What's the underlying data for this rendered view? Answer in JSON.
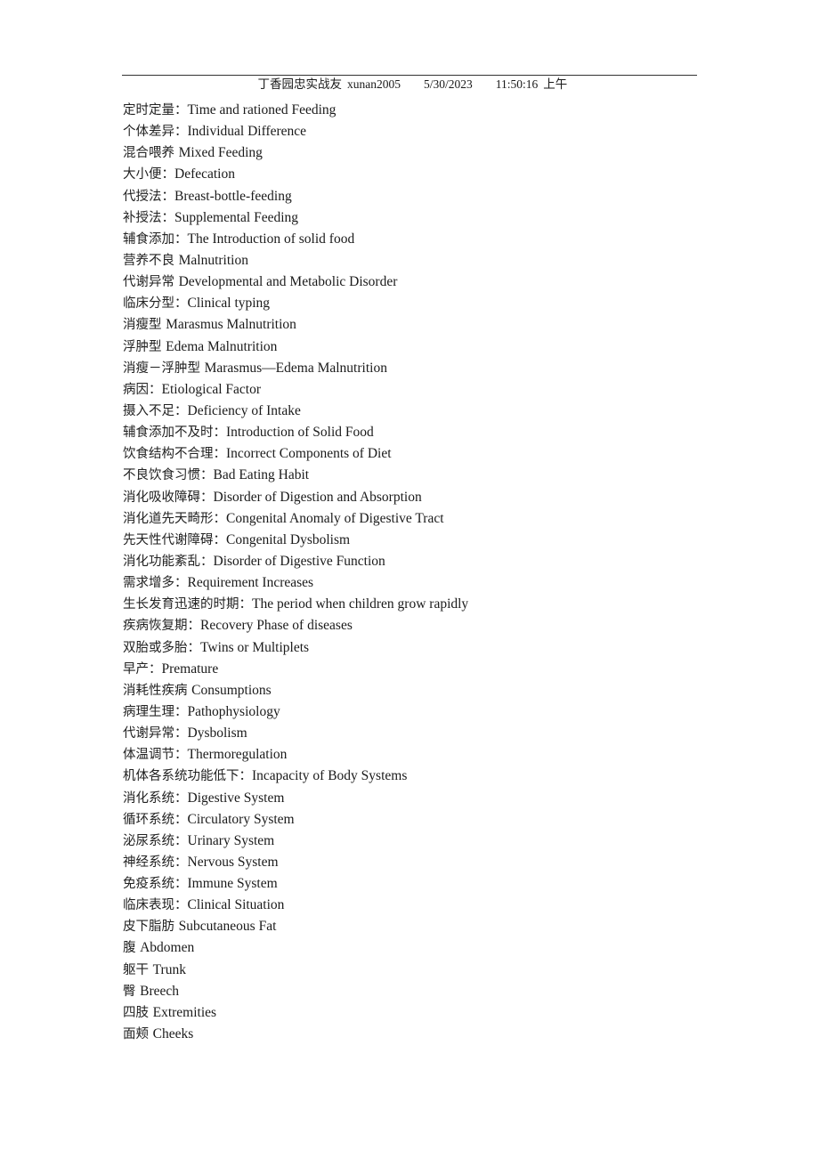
{
  "header": {
    "author": "丁香园忠实战友",
    "username": "xunan2005",
    "date": "5/30/2023",
    "time": "11:50:16",
    "ampm": "上午"
  },
  "entries": [
    {
      "zh": "定时定量：",
      "en": "Time and rationed Feeding"
    },
    {
      "zh": "个体差异：",
      "en": "Individual Difference"
    },
    {
      "zh": "混合喂养 ",
      "en": "Mixed Feeding"
    },
    {
      "zh": "大小便：",
      "en": "Defecation"
    },
    {
      "zh": "代授法：",
      "en": "Breast-bottle-feeding"
    },
    {
      "zh": "补授法：",
      "en": "Supplemental Feeding"
    },
    {
      "zh": "辅食添加：",
      "en": "The Introduction of solid food"
    },
    {
      "zh": "营养不良 ",
      "en": "Malnutrition"
    },
    {
      "zh": "代谢异常 ",
      "en": "Developmental and Metabolic Disorder"
    },
    {
      "zh": "临床分型：",
      "en": "Clinical typing"
    },
    {
      "zh": "消瘦型 ",
      "en": "Marasmus Malnutrition"
    },
    {
      "zh": "浮肿型 ",
      "en": "Edema Malnutrition"
    },
    {
      "zh": "消瘦－浮肿型 ",
      "en": "Marasmus—Edema Malnutrition"
    },
    {
      "zh": "病因：",
      "en": "Etiological Factor"
    },
    {
      "zh": "摄入不足：",
      "en": "Deficiency of Intake"
    },
    {
      "zh": "辅食添加不及时：",
      "en": "Introduction of Solid Food"
    },
    {
      "zh": "饮食结构不合理：",
      "en": "Incorrect Components of Diet"
    },
    {
      "zh": "不良饮食习惯：",
      "en": "Bad Eating Habit"
    },
    {
      "zh": "消化吸收障碍：",
      "en": "Disorder of Digestion and Absorption"
    },
    {
      "zh": "消化道先天畸形：",
      "en": "Congenital Anomaly of Digestive Tract"
    },
    {
      "zh": "先天性代谢障碍：",
      "en": "Congenital Dysbolism"
    },
    {
      "zh": "消化功能紊乱：",
      "en": "Disorder of Digestive Function"
    },
    {
      "zh": "需求增多：",
      "en": "Requirement Increases"
    },
    {
      "zh": "生长发育迅速的时期：",
      "en": "The period when children grow rapidly"
    },
    {
      "zh": "疾病恢复期：",
      "en": "Recovery Phase of diseases"
    },
    {
      "zh": "双胎或多胎：",
      "en": "Twins or Multiplets"
    },
    {
      "zh": "早产：",
      "en": "Premature"
    },
    {
      "zh": "消耗性疾病 ",
      "en": "Consumptions"
    },
    {
      "zh": "病理生理：",
      "en": "Pathophysiology"
    },
    {
      "zh": "代谢异常：",
      "en": "Dysbolism"
    },
    {
      "zh": "体温调节：",
      "en": "Thermoregulation"
    },
    {
      "zh": "机体各系统功能低下：",
      "en": "Incapacity of Body Systems"
    },
    {
      "zh": "消化系统：",
      "en": "Digestive System"
    },
    {
      "zh": "循环系统：",
      "en": "Circulatory System"
    },
    {
      "zh": "泌尿系统：",
      "en": "Urinary System"
    },
    {
      "zh": "神经系统：",
      "en": "Nervous System"
    },
    {
      "zh": "免疫系统：",
      "en": "Immune System"
    },
    {
      "zh": "临床表现：",
      "en": "Clinical Situation"
    },
    {
      "zh": "皮下脂肪 ",
      "en": "Subcutaneous Fat"
    },
    {
      "zh": "腹 ",
      "en": "Abdomen"
    },
    {
      "zh": "躯干 ",
      "en": "Trunk"
    },
    {
      "zh": "臀 ",
      "en": "Breech"
    },
    {
      "zh": "四肢 ",
      "en": "Extremities"
    },
    {
      "zh": "面颊 ",
      "en": "Cheeks"
    }
  ]
}
